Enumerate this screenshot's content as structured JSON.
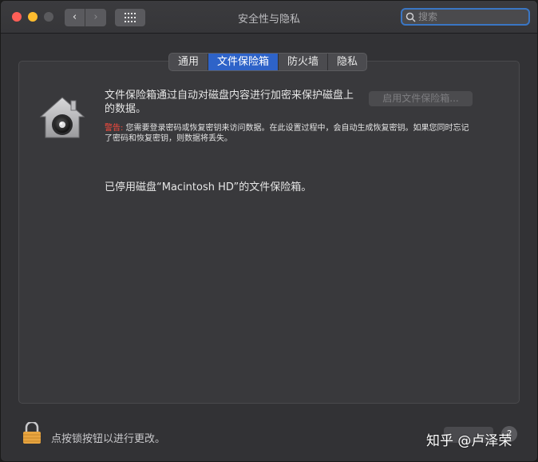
{
  "window": {
    "title": "安全性与隐私"
  },
  "toolbar": {
    "back_glyph": "‹",
    "forward_glyph": "›",
    "search_placeholder": "搜索",
    "search_value": ""
  },
  "tabs": [
    {
      "label": "通用",
      "active": false
    },
    {
      "label": "文件保险箱",
      "active": true
    },
    {
      "label": "防火墙",
      "active": false
    },
    {
      "label": "隐私",
      "active": false
    }
  ],
  "filevault": {
    "description": "文件保险箱通过自动对磁盘内容进行加密来保护磁盘上的数据。",
    "enable_button": "启用文件保险箱...",
    "warning_label": "警告:",
    "warning_text": " 您需要登录密码或恢复密钥来访问数据。在此设置过程中，会自动生成恢复密钥。如果您同时忘记了密码和恢复密钥，则数据将丢失。",
    "status": "已停用磁盘“Macintosh HD”的文件保险箱。"
  },
  "footer": {
    "lock_text": "点按锁按钮以进行更改。",
    "help_label": "?"
  },
  "watermark": "知乎 @卢泽荣",
  "icons": {
    "house": "filevault-house-icon",
    "lock": "lock-icon",
    "search": "search-icon",
    "grid": "grid-icon"
  },
  "colors": {
    "accent": "#2e63c8",
    "warning": "#ff4a3d",
    "close": "#fe5f57",
    "minimize": "#febc2e"
  }
}
